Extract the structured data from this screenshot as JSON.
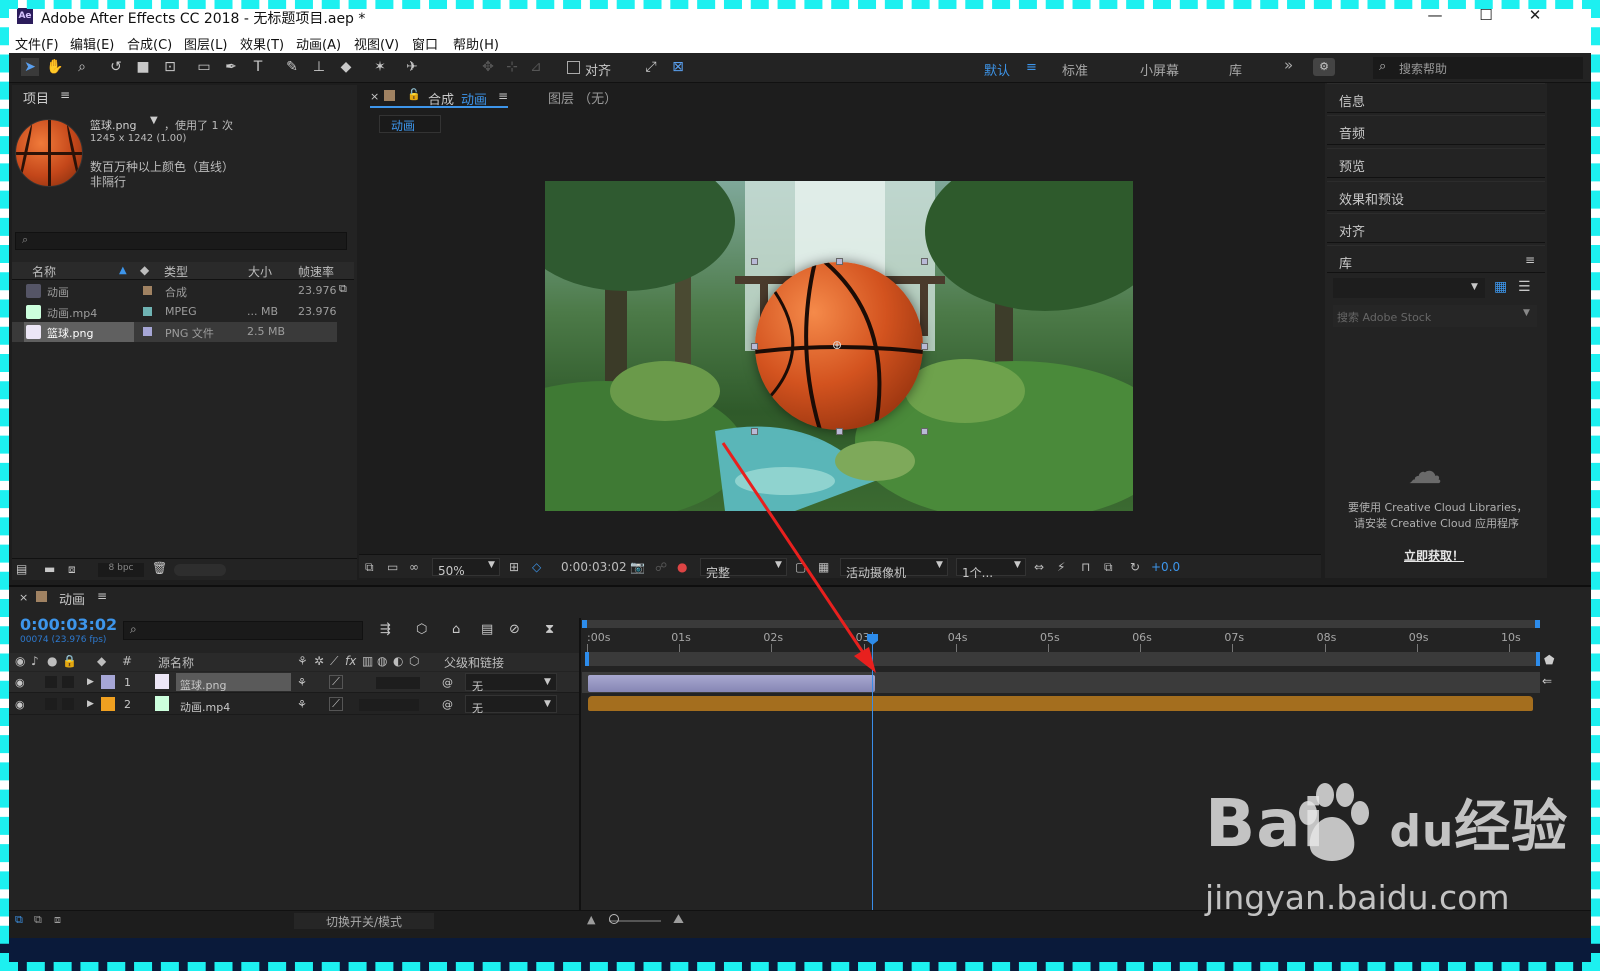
{
  "window": {
    "title": "Adobe After Effects CC 2018 - 无标题项目.aep *",
    "logo": "Ae",
    "minimize": "—",
    "maximize": "☐",
    "close": "✕"
  },
  "menu": [
    "文件(F)",
    "编辑(E)",
    "合成(C)",
    "图层(L)",
    "效果(T)",
    "动画(A)",
    "视图(V)",
    "窗口",
    "帮助(H)"
  ],
  "toolbar": {
    "snap_label": "对齐",
    "workspaces": [
      "默认",
      "标准",
      "小屏幕",
      "库"
    ],
    "more": "»",
    "search_placeholder": "搜索帮助"
  },
  "project": {
    "title": "项目",
    "asset_name": "篮球.png",
    "asset_usage": "，使用了 1 次",
    "asset_dims": "1245 x 1242 (1.00)",
    "asset_color": "数百万种以上颜色（直线）",
    "asset_interlace": "非隔行",
    "search_icon": "⌕",
    "columns": [
      "名称",
      "类型",
      "大小",
      "帧速率"
    ],
    "rows": [
      {
        "name": "动画",
        "type": "合成",
        "size": "",
        "fps": "23.976",
        "color": "#a08262"
      },
      {
        "name": "动画.mp4",
        "type": "MPEG",
        "size": "... MB",
        "fps": "23.976",
        "color": "#6fb3b3"
      },
      {
        "name": "篮球.png",
        "type": "PNG 文件",
        "size": "2.5 MB",
        "fps": "",
        "color": "#a6a6d6"
      }
    ],
    "bpc": "8 bpc"
  },
  "viewer": {
    "tab_prefix": "合成",
    "tab_name": "动画",
    "layer_tab": "图层 （无）",
    "comp_chip": "动画",
    "zoom": "50%",
    "timecode": "0:00:03:02",
    "quality": "完整",
    "camera": "活动摄像机",
    "views": "1个...",
    "exposure": "+0.0"
  },
  "right_panels": [
    "信息",
    "音频",
    "预览",
    "效果和预设",
    "对齐"
  ],
  "library": {
    "title": "库",
    "search_placeholder": "搜索 Adobe Stock",
    "message_line1": "要使用 Creative Cloud Libraries，",
    "message_line2": "请安装 Creative Cloud 应用程序",
    "link": "立即获取！"
  },
  "timeline": {
    "comp_name": "动画",
    "timecode": "0:00:03:02",
    "frame_info": "00074 (23.976 fps)",
    "columns": {
      "number": "#",
      "source": "源名称",
      "parent": "父级和链接"
    },
    "layers": [
      {
        "num": "1",
        "name": "篮球.png",
        "parent": "无",
        "color": "#a6a6d6"
      },
      {
        "num": "2",
        "name": "动画.mp4",
        "parent": "无",
        "color": "#f0a020"
      }
    ],
    "ruler": [
      ":00s",
      "01s",
      "02s",
      "03s",
      "04s",
      "05s",
      "06s",
      "07s",
      "08s",
      "09s",
      "10s"
    ],
    "footer_toggle": "切换开关/模式"
  },
  "watermark": {
    "brand_left": "Bai",
    "brand_mid": "du",
    "brand_right": "经验",
    "url": "jingyan.baidu.com"
  },
  "colors": {
    "accent": "#2d8ceb",
    "panel": "#232323",
    "bg": "#1d1d1d",
    "frame": "#1df0f0",
    "arrow": "#e8201e"
  }
}
